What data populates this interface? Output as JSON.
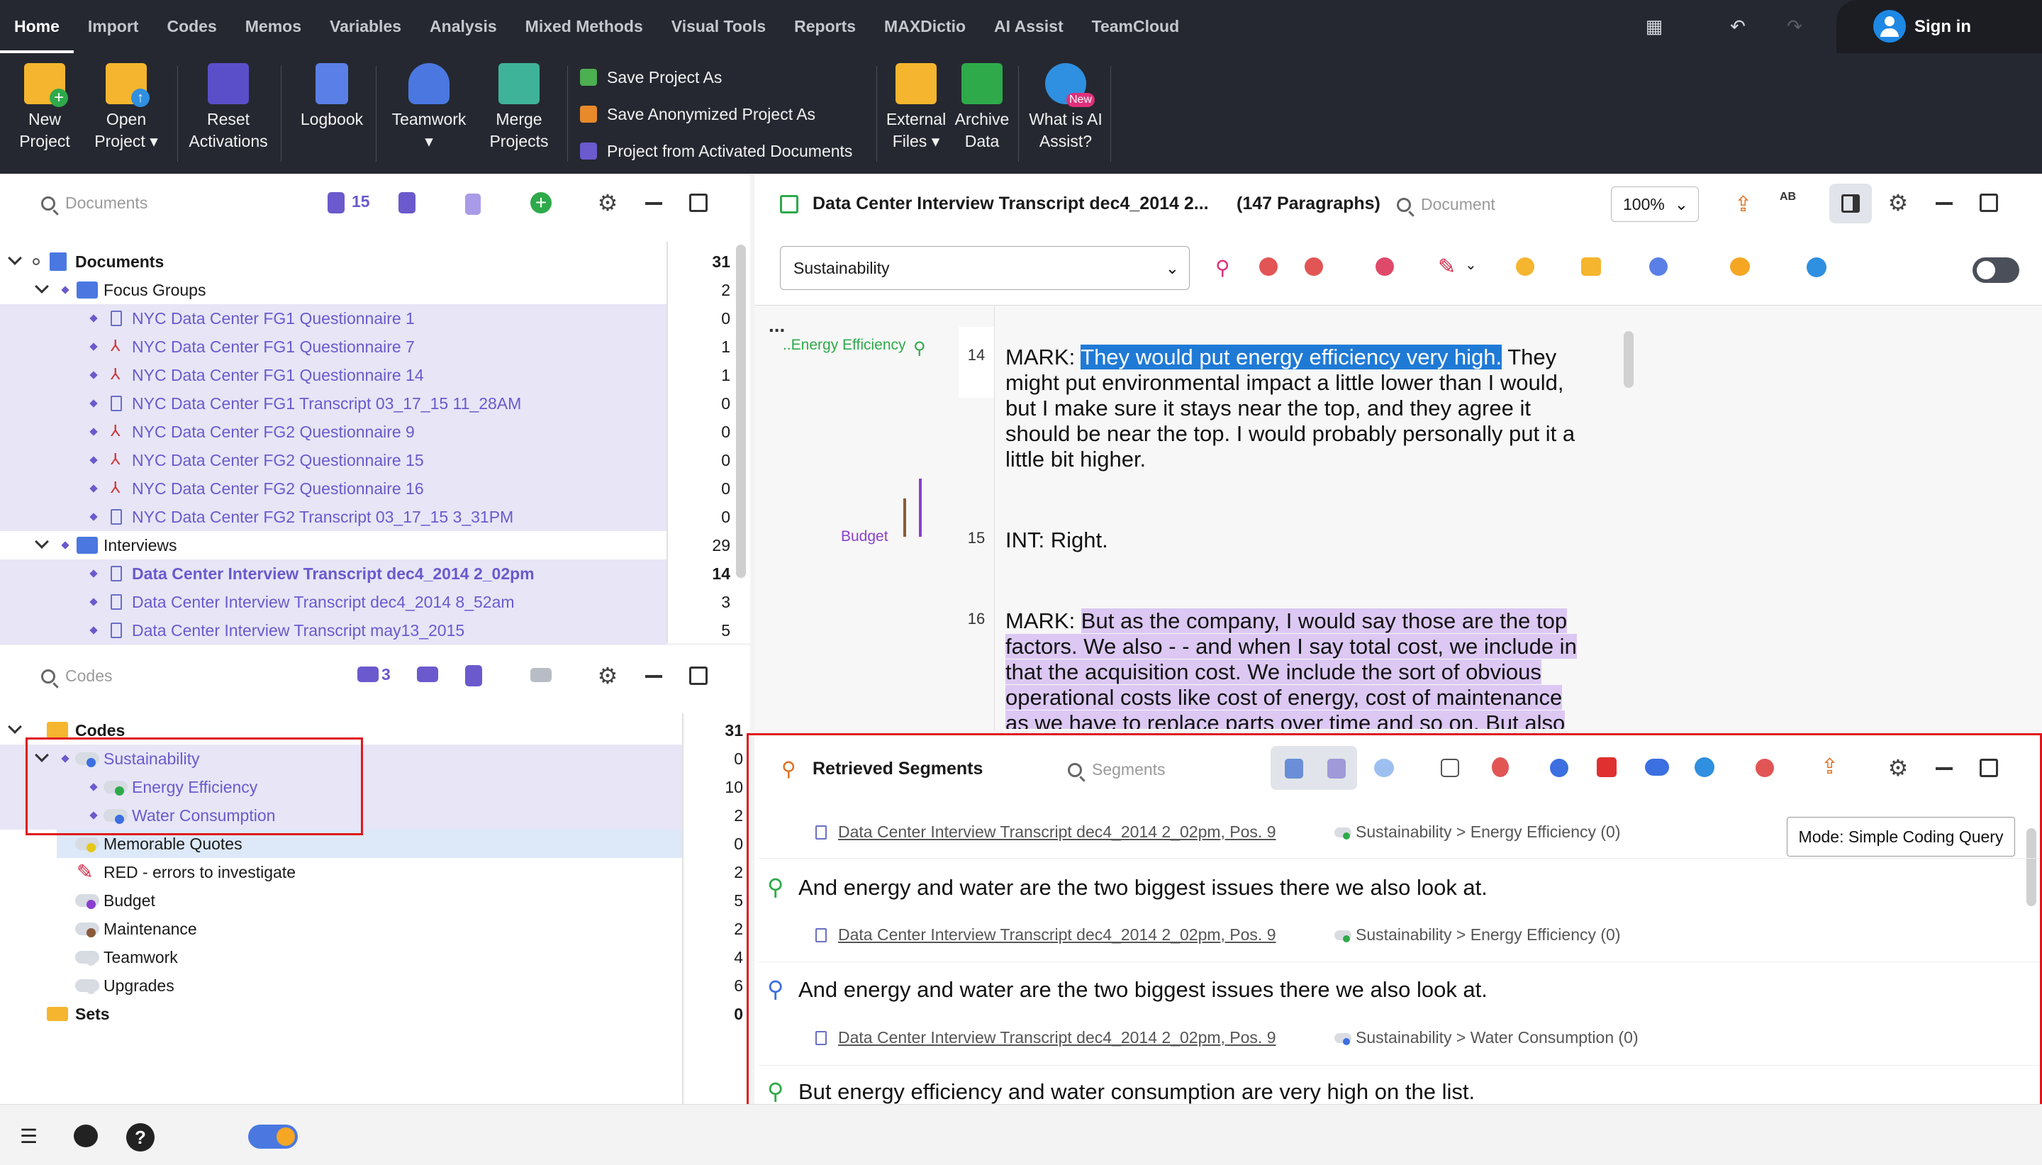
{
  "topbar": {
    "tabs": [
      "Home",
      "Import",
      "Codes",
      "Memos",
      "Variables",
      "Analysis",
      "Mixed Methods",
      "Visual Tools",
      "Reports",
      "MAXDictio",
      "AI Assist",
      "TeamCloud"
    ],
    "active_tab": "Home",
    "sign_in": "Sign in"
  },
  "ribbon": {
    "new_project": "New\nProject",
    "open_project": "Open\nProject ▾",
    "reset_activations": "Reset\nActivations",
    "logbook": "Logbook",
    "teamwork": "Teamwork\n▾",
    "merge_projects": "Merge\nProjects",
    "save_project_as": "Save Project As",
    "save_anonymized": "Save Anonymized Project As",
    "project_from_activated": "Project from Activated Documents",
    "external_files": "External\nFiles ▾",
    "archive_data": "Archive\nData",
    "what_is_ai": "What is AI\nAssist?",
    "new_badge": "New"
  },
  "documents_pane": {
    "search_placeholder": "Documents",
    "activated_count": "15",
    "root": {
      "label": "Documents",
      "count": "31"
    },
    "groups": [
      {
        "label": "Focus Groups",
        "count": "2",
        "items": [
          {
            "label": "NYC Data Center FG1 Questionnaire 1",
            "count": "0",
            "type": "text"
          },
          {
            "label": "NYC Data Center FG1 Questionnaire 7",
            "count": "1",
            "type": "pdf"
          },
          {
            "label": "NYC Data Center FG1 Questionnaire 14",
            "count": "1",
            "type": "pdf"
          },
          {
            "label": "NYC Data Center FG1 Transcript 03_17_15 11_28AM",
            "count": "0",
            "type": "text"
          },
          {
            "label": "NYC Data Center FG2 Questionnaire 9",
            "count": "0",
            "type": "pdf"
          },
          {
            "label": "NYC Data Center FG2 Questionnaire 15",
            "count": "0",
            "type": "pdf"
          },
          {
            "label": "NYC Data Center FG2 Questionnaire 16",
            "count": "0",
            "type": "pdf"
          },
          {
            "label": "NYC Data Center FG2 Transcript 03_17_15 3_31PM",
            "count": "0",
            "type": "text"
          }
        ]
      },
      {
        "label": "Interviews",
        "count": "29",
        "items": [
          {
            "label": "Data Center Interview Transcript dec4_2014 2_02pm",
            "count": "14",
            "type": "text"
          },
          {
            "label": "Data Center Interview Transcript dec4_2014 8_52am",
            "count": "3",
            "type": "text"
          },
          {
            "label": "Data Center Interview Transcript may13_2015",
            "count": "5",
            "type": "text"
          }
        ]
      }
    ]
  },
  "codes_pane": {
    "search_placeholder": "Codes",
    "activated_count": "3",
    "root": {
      "label": "Codes",
      "count": "31"
    },
    "items": [
      {
        "label": "Sustainability",
        "count": "0"
      },
      {
        "label": "Energy Efficiency",
        "count": "10"
      },
      {
        "label": "Water Consumption",
        "count": "2"
      },
      {
        "label": "Memorable Quotes",
        "count": "0"
      },
      {
        "label": "RED - errors to investigate",
        "count": "2"
      },
      {
        "label": "Budget",
        "count": "5"
      },
      {
        "label": "Maintenance",
        "count": "2"
      },
      {
        "label": "Teamwork",
        "count": "4"
      },
      {
        "label": "Upgrades",
        "count": "6"
      }
    ],
    "sets": {
      "label": "Sets",
      "count": "0"
    }
  },
  "document_browser": {
    "title": "Data Center Interview Transcript dec4_2014 2...",
    "paragraphs": "(147 Paragraphs)",
    "search_placeholder": "Document",
    "zoom": "100%",
    "code_select": "Sustainability",
    "ellipsis": "...",
    "margin_code_1": "..Energy Efficiency",
    "margin_code_2": "Budget",
    "p14_num": "14",
    "p14_l1_pre": "MARK:  ",
    "p14_l1_sel": "They would put energy efficiency very high.",
    "p14_l1_post": "  They",
    "p14_l2": "might put environmental impact a little lower than I would,",
    "p14_l3": "but I make sure it stays near the top, and they agree it",
    "p14_l4": "should be near the top.  I would probably personally put it a",
    "p14_l5": "little bit higher.",
    "p15_num": "15",
    "p15": "INT:  Right.",
    "p16_num": "16",
    "p16_l1_pre": "MARK:  ",
    "p16_l1_mark": "But as the company, I would say those are the top",
    "p16_l2": "factors.  We also - - and when I say total cost, we include in",
    "p16_l3": "that the acquisition cost.  We include the sort of obvious",
    "p16_l4": "operational costs like cost of energy, cost of maintenance",
    "p16_l5": "as we have to replace parts over time and so on.  But also"
  },
  "retrieved_segments": {
    "title": "Retrieved Segments",
    "search_placeholder": "Segments",
    "mode": "Mode: Simple Coding Query",
    "segments": [
      {
        "source": "Data Center Interview Transcript dec4_2014 2_02pm, Pos. 9",
        "code": "Sustainability > Energy Efficiency (0)",
        "text": ""
      },
      {
        "source": "Data Center Interview Transcript dec4_2014 2_02pm, Pos. 9",
        "code": "Sustainability > Energy Efficiency (0)",
        "text": "And energy and water are the two biggest issues there we also look at."
      },
      {
        "source": "Data Center Interview Transcript dec4_2014 2_02pm, Pos. 9",
        "code": "Sustainability > Water Consumption (0)",
        "text": "And energy and water are the two biggest issues there we also look at."
      },
      {
        "source": "",
        "code": "",
        "text": "But energy efficiency and water consumption are very high on the list."
      }
    ]
  },
  "colors": {
    "topbar": "#252830",
    "highlight_row": "#e7e5f6",
    "purple": "#6a5acd",
    "selection_blue": "#1f7ad6",
    "code_green": "#2eaa4a",
    "code_blue": "#3c6fe0",
    "red_box": "#e0161c"
  }
}
